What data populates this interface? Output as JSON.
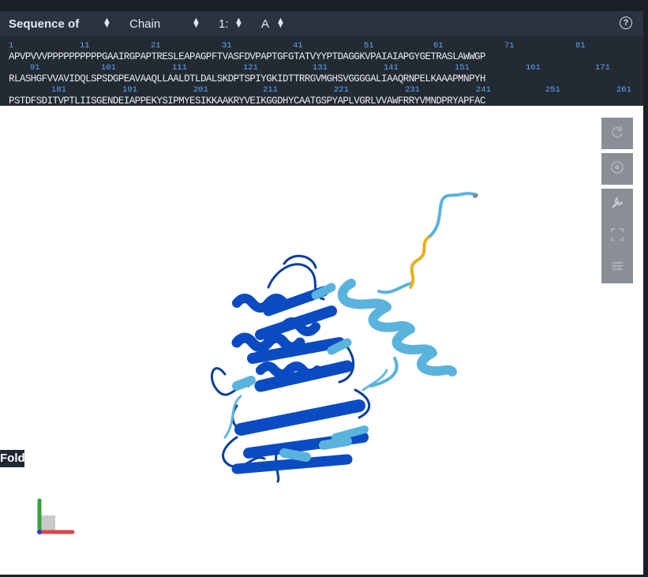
{
  "header": {
    "title": "Sequence of",
    "selectors": [
      {
        "value": "Chain"
      },
      {
        "value": "1:"
      },
      {
        "value": "A"
      }
    ],
    "help_label": "?"
  },
  "sequence": {
    "lines": [
      {
        "numbers": [
          "1",
          "11",
          "21",
          "31",
          "41",
          "51",
          "61",
          "71",
          "81"
        ],
        "text": "APVPVVVPPPPPPPPPPGAAIRGPAPTRESLEAPAGPFTVASFDVPAPTGFGTATVYYPTDAGGKVPAIAIAPGYGETRASLAWWGP"
      },
      {
        "numbers": [
          "91",
          "101",
          "111",
          "121",
          "131",
          "141",
          "151",
          "161",
          "171"
        ],
        "text": "RLASHGFVVAVIDQLSPSDGPEAVAAQLLAALDTLDALSKDPTSPIYGKIDTTRRGVMGHSVGGGGALIAAQRNPELKAAAPMNPYH"
      },
      {
        "numbers": [
          "181",
          "191",
          "201",
          "211",
          "221",
          "231",
          "241",
          "251",
          "261"
        ],
        "text": "PSTDFSDITVPTLIISGENDEIAPPEKYSIPMYESIKKAAKRYVEIKGGDHYCAATGSPYAPLVGRLVVAWFRRYVMNDPRYAPFAC"
      }
    ]
  },
  "viewer": {
    "badge": "Fold",
    "toolbar": [
      {
        "icon": "refresh-icon"
      },
      {
        "icon": "camera-icon"
      },
      {
        "icon": "wrench-icon"
      },
      {
        "icon": "expand-icon"
      },
      {
        "icon": "sliders-icon"
      }
    ],
    "colors": {
      "very_high": "#0053d6",
      "confident": "#65cbf3",
      "low": "#ffdb13",
      "very_low": "#ff7d45"
    }
  }
}
